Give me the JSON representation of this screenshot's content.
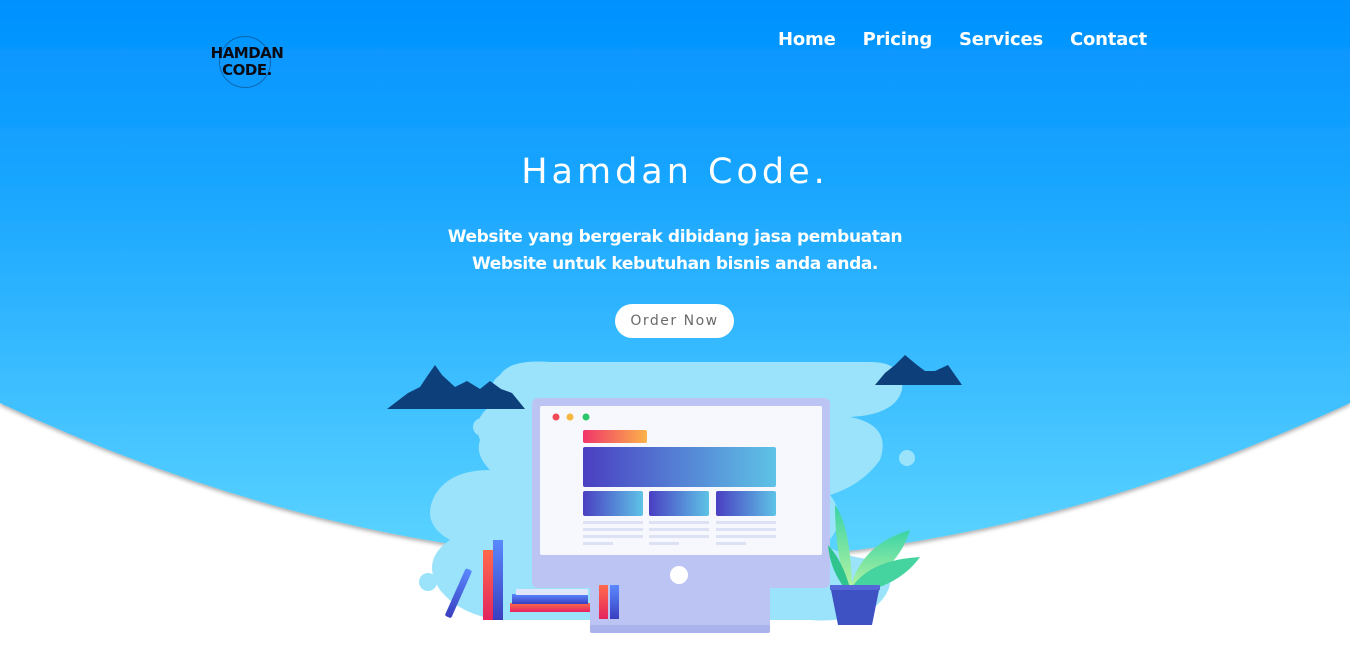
{
  "brand": {
    "logo_line1": "HAMDAN",
    "logo_line2": "CODE."
  },
  "nav": {
    "items": [
      {
        "label": "Home"
      },
      {
        "label": "Pricing"
      },
      {
        "label": "Services"
      },
      {
        "label": "Contact"
      }
    ]
  },
  "hero": {
    "title": "Hamdan Code.",
    "subtitle_line1": "Website yang bergerak dibidang jasa pembuatan",
    "subtitle_line2": "Website untuk kebutuhan bisnis anda anda.",
    "cta_label": "Order Now"
  },
  "colors": {
    "hero_top": "#0093ff",
    "hero_bottom": "#56d1ff",
    "text_on_hero": "#ffffff",
    "mountain": "#0d3f7a",
    "blob": "#9be3fb",
    "monitor_frame": "#bcc4f3"
  },
  "icons": {
    "logo": "brand-logo-icon",
    "illustration": "desktop-website-illustration"
  }
}
